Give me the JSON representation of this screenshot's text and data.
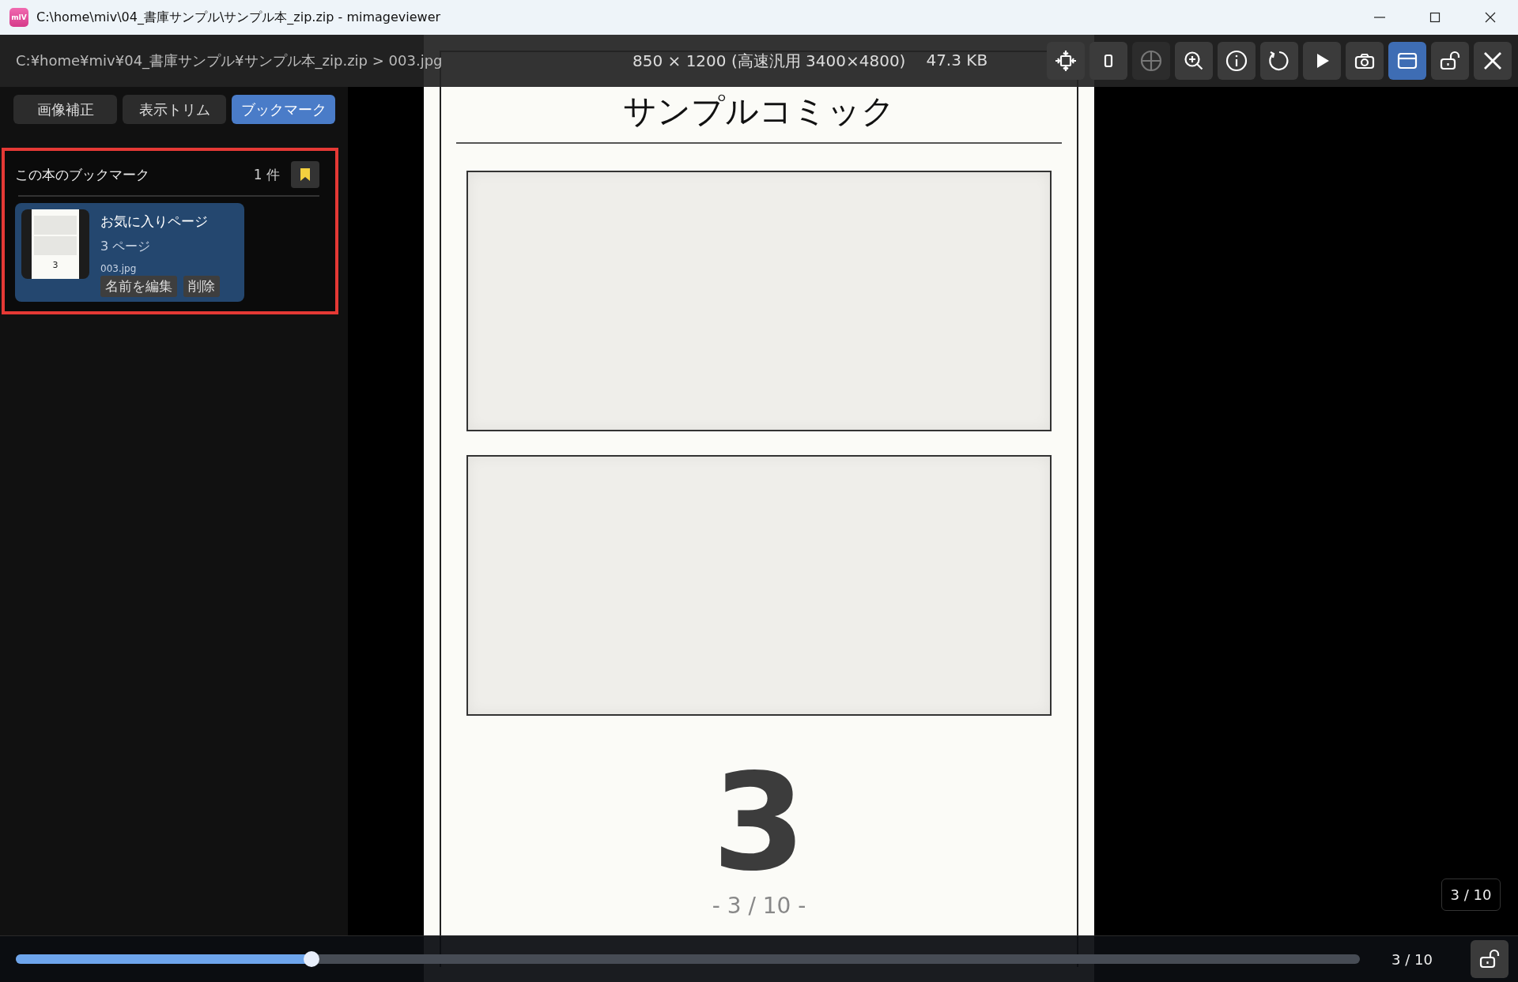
{
  "window": {
    "app_icon": "mIV",
    "title": "C:\\home\\miv\\04_書庫サンプル\\サンプル本_zip.zip - mimageviewer"
  },
  "top_bar": {
    "path": "C:¥home¥miv¥04_書庫サンプル¥サンプル本_zip.zip > 003.jpg",
    "image_info": "850 × 1200 (高速汎用 3400×4800)",
    "file_size": "47.3 KB"
  },
  "toolbar": [
    {
      "kind": "fit",
      "selected": false,
      "disabled": false
    },
    {
      "kind": "single",
      "selected": false,
      "disabled": false
    },
    {
      "kind": "crosshair",
      "selected": false,
      "disabled": true
    },
    {
      "kind": "zoom",
      "selected": false,
      "disabled": false
    },
    {
      "kind": "info",
      "selected": false,
      "disabled": false
    },
    {
      "kind": "rotate",
      "selected": false,
      "disabled": false
    },
    {
      "kind": "play",
      "selected": false,
      "disabled": false
    },
    {
      "kind": "camera",
      "selected": false,
      "disabled": false
    },
    {
      "kind": "window",
      "selected": true,
      "disabled": false
    },
    {
      "kind": "unlock",
      "selected": false,
      "disabled": false
    },
    {
      "kind": "close",
      "selected": false,
      "disabled": false
    }
  ],
  "sidebar": {
    "tabs": [
      {
        "label": "画像補正",
        "selected": false
      },
      {
        "label": "表示トリム",
        "selected": false
      },
      {
        "label": "ブックマーク",
        "selected": true
      }
    ],
    "bookmarks": {
      "title": "この本のブックマーク",
      "count": "1 件",
      "items": [
        {
          "name": "お気に入りページ",
          "page": "3 ページ",
          "file": "003.jpg",
          "thumbnail_number": "3",
          "actions": [
            "名前を編集",
            "削除"
          ]
        }
      ]
    }
  },
  "page": {
    "title": "サンプルコミック",
    "number": "3",
    "footer": "- 3 / 10 -"
  },
  "page_counter": "3 / 10",
  "bottom_bar": {
    "slider": {
      "level": 0.22
    },
    "counter": "3 / 10"
  }
}
